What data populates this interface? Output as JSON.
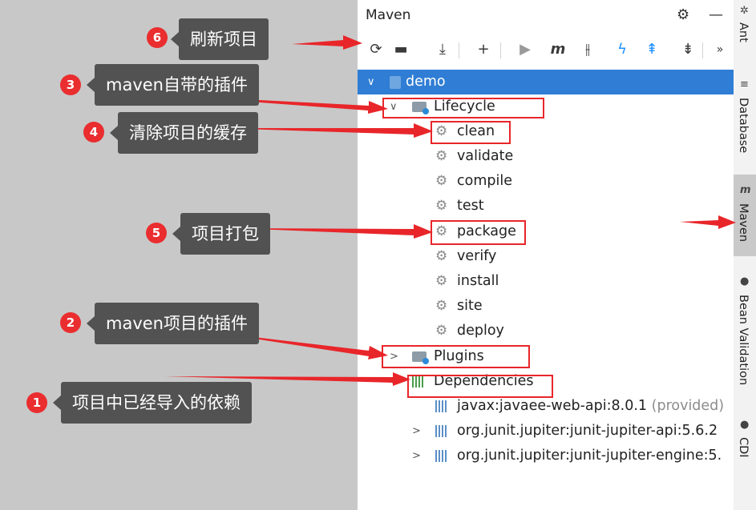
{
  "panel": {
    "title": "Maven",
    "icons": {
      "settings": "gear-icon",
      "minimize": "minus-icon"
    }
  },
  "toolbar": {
    "reload": "⟳",
    "generate": "▬",
    "download": "⤓",
    "add": "+",
    "run": "▶",
    "execute": "m",
    "skip_tests": "⫲",
    "show_deps": "ϟ",
    "expand": "⇞",
    "collapse": "⇟",
    "more": "»"
  },
  "tree": {
    "root": "demo",
    "lifecycle": {
      "label": "Lifecycle",
      "goals": [
        "clean",
        "validate",
        "compile",
        "test",
        "package",
        "verify",
        "install",
        "site",
        "deploy"
      ]
    },
    "plugins": "Plugins",
    "dependencies": {
      "label": "Dependencies",
      "items": [
        {
          "name": "javax:javaee-web-api:8.0.1",
          "scope": "(provided)"
        },
        {
          "name": "org.junit.jupiter:junit-jupiter-api:5.6.2",
          "scope": ""
        },
        {
          "name": "org.junit.jupiter:junit-jupiter-engine:5.",
          "scope": ""
        }
      ]
    }
  },
  "side_tabs": [
    "Ant",
    "Database",
    "Maven",
    "Bean Validation",
    "CDI"
  ],
  "callouts": [
    {
      "num": "6",
      "text": "刷新项目"
    },
    {
      "num": "3",
      "text": "maven自带的插件"
    },
    {
      "num": "4",
      "text": "清除项目的缓存"
    },
    {
      "num": "5",
      "text": "项目打包"
    },
    {
      "num": "2",
      "text": "maven项目的插件"
    },
    {
      "num": "1",
      "text": "项目中已经导入的依赖"
    }
  ],
  "colors": {
    "accent": "#e8262a",
    "selection": "#2f7dd4",
    "callout_bg": "#525252",
    "badge": "#ea2d2f"
  }
}
